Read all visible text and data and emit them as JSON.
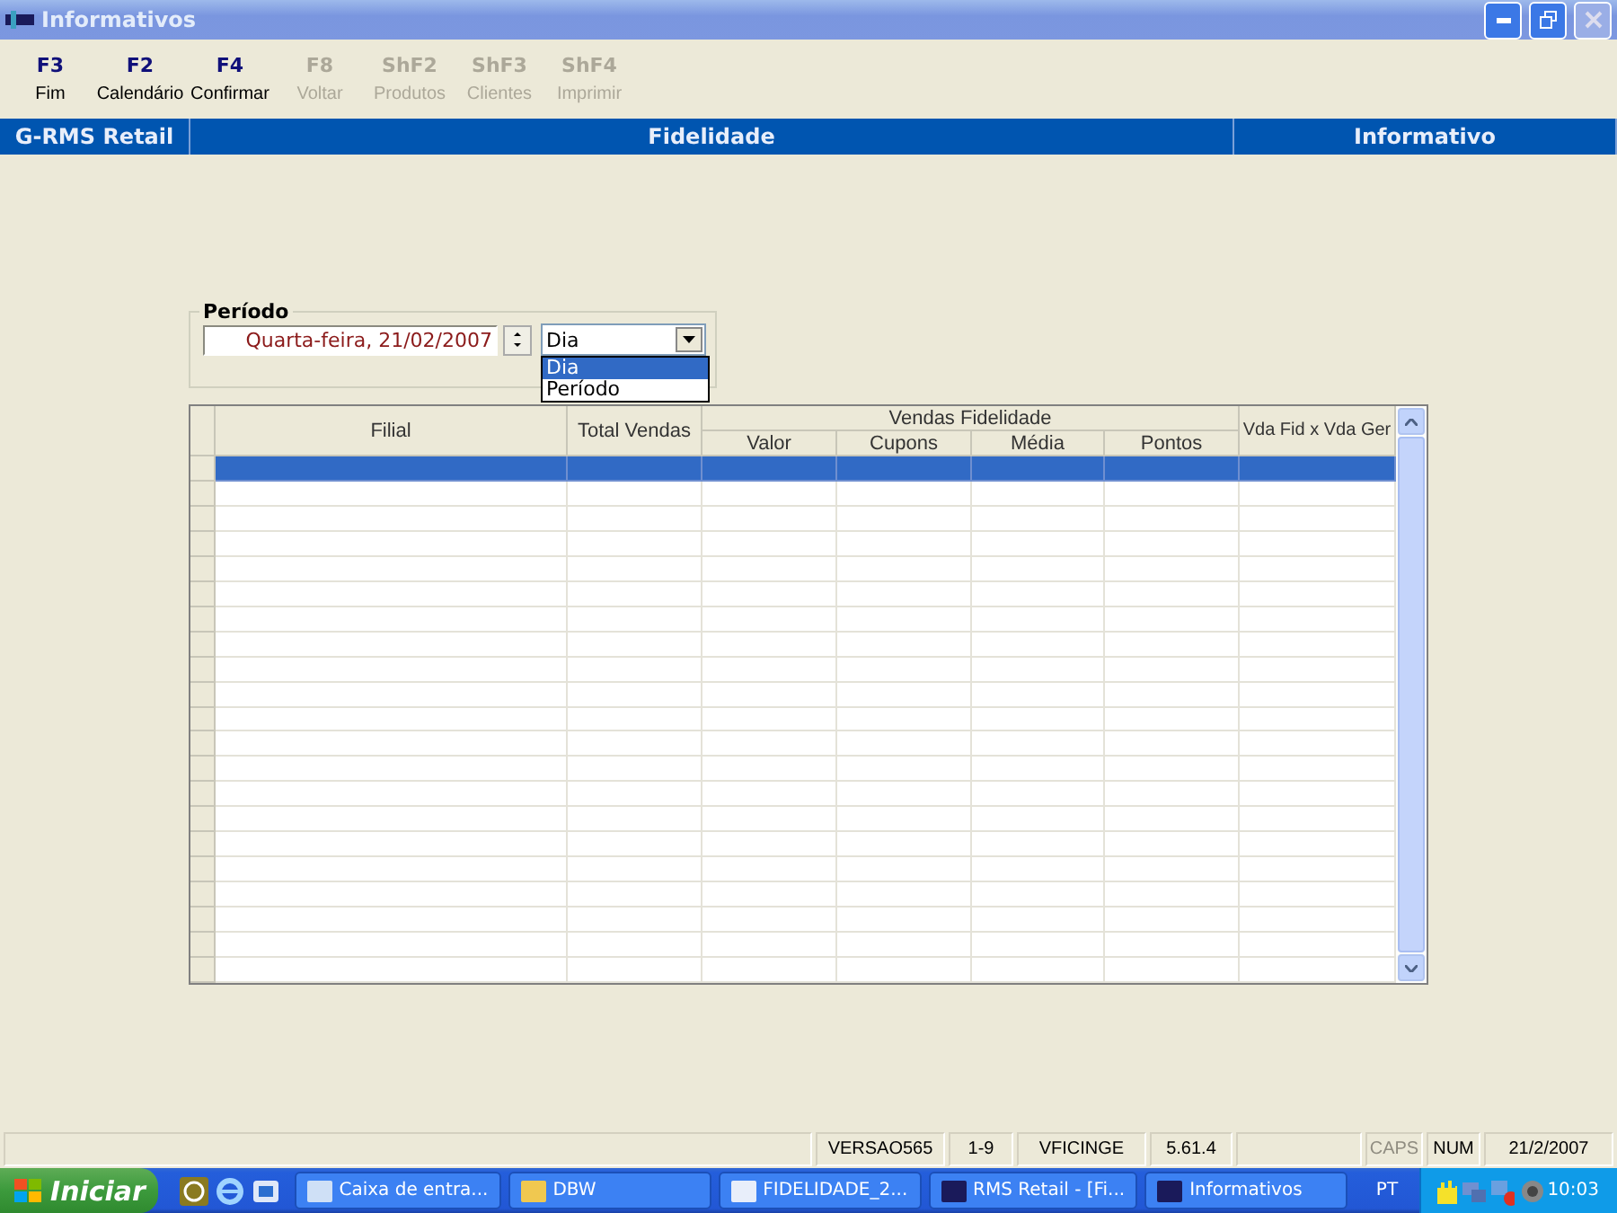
{
  "window": {
    "title": "Informativos"
  },
  "toolbar": [
    {
      "key": "F3",
      "label": "Fim",
      "disabled": false
    },
    {
      "key": "F2",
      "label": "Calendário",
      "disabled": false
    },
    {
      "key": "F4",
      "label": "Confirmar",
      "disabled": false
    },
    {
      "key": "F8",
      "label": "Voltar",
      "disabled": true
    },
    {
      "key": "ShF2",
      "label": "Produtos",
      "disabled": true
    },
    {
      "key": "ShF3",
      "label": "Clientes",
      "disabled": true
    },
    {
      "key": "ShF4",
      "label": "Imprimir",
      "disabled": true
    }
  ],
  "header": [
    "G-RMS Retail",
    "Fidelidade",
    "Informativo"
  ],
  "period": {
    "label": "Período",
    "date": "Quarta-feira, 21/02/2007",
    "mode": "Dia",
    "options": [
      {
        "label": "Dia",
        "selected": true
      },
      {
        "label": "Período",
        "selected": false
      }
    ]
  },
  "grid": {
    "group": "Vendas Fidelidade",
    "columns": [
      "Filial",
      "Total Vendas",
      "Valor",
      "Cupons",
      "Média",
      "Pontos",
      "Vda Fid x Vda Ger"
    ],
    "rows": [
      {
        "selected": true
      },
      {
        "selected": false
      },
      {
        "selected": false
      },
      {
        "selected": false
      },
      {
        "selected": false
      },
      {
        "selected": false
      },
      {
        "selected": false
      },
      {
        "selected": false
      },
      {
        "selected": false
      },
      {
        "selected": false
      },
      {
        "selected": false
      },
      {
        "selected": false
      },
      {
        "selected": false
      },
      {
        "selected": false
      },
      {
        "selected": false
      },
      {
        "selected": false
      },
      {
        "selected": false
      },
      {
        "selected": false
      },
      {
        "selected": false
      },
      {
        "selected": false
      },
      {
        "selected": false
      }
    ]
  },
  "status_bar": [
    {
      "kind": "blank"
    },
    {
      "kind": "text",
      "text": "VERSAO565",
      "disabled": false
    },
    {
      "kind": "text",
      "text": "1-9",
      "disabled": false
    },
    {
      "kind": "text",
      "text": "VFICINGE",
      "disabled": false
    },
    {
      "kind": "text",
      "text": "5.61.4",
      "disabled": false
    },
    {
      "kind": "blank"
    },
    {
      "kind": "text",
      "text": "CAPS",
      "disabled": true
    },
    {
      "kind": "text",
      "text": "NUM",
      "disabled": false
    },
    {
      "kind": "text",
      "text": "21/2/2007",
      "disabled": false
    }
  ],
  "taskbar": {
    "start": "Iniciar",
    "tasks": [
      {
        "label": "Caixa de entra..."
      },
      {
        "label": "DBW"
      },
      {
        "label": "FIDELIDADE_2..."
      },
      {
        "label": "RMS Retail - [Fi..."
      },
      {
        "label": "Informativos"
      }
    ],
    "language": "PT",
    "clock": "10:03"
  }
}
